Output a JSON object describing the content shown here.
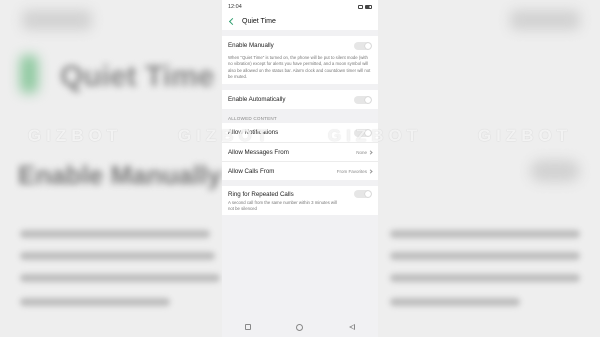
{
  "statusbar": {
    "time": "12:04"
  },
  "header": {
    "title": "Quiet Time"
  },
  "manual": {
    "label": "Enable Manually",
    "toggle_on": false,
    "description": "When \"Quiet Time\" is turned on, the phone will be put to silent mode (with no vibration) except for alerts you have permitted, and a moon symbol will also be allowed on the status bar. Alarm clock and countdown timer will not be muted."
  },
  "automatic": {
    "label": "Enable Automatically",
    "toggle_on": false
  },
  "allowed": {
    "section_label": "ALLOWED CONTENT",
    "notifications_label": "Allow Notifications",
    "messages_label": "Allow Messages From",
    "messages_value": "None",
    "calls_label": "Allow Calls From",
    "calls_value": "From Favorites"
  },
  "repeated": {
    "label": "Ring for Repeated Calls",
    "description": "A second call from the same number within 3 minutes will not be silenced",
    "toggle_on": false
  },
  "watermark": {
    "text": "GIZBOT"
  }
}
